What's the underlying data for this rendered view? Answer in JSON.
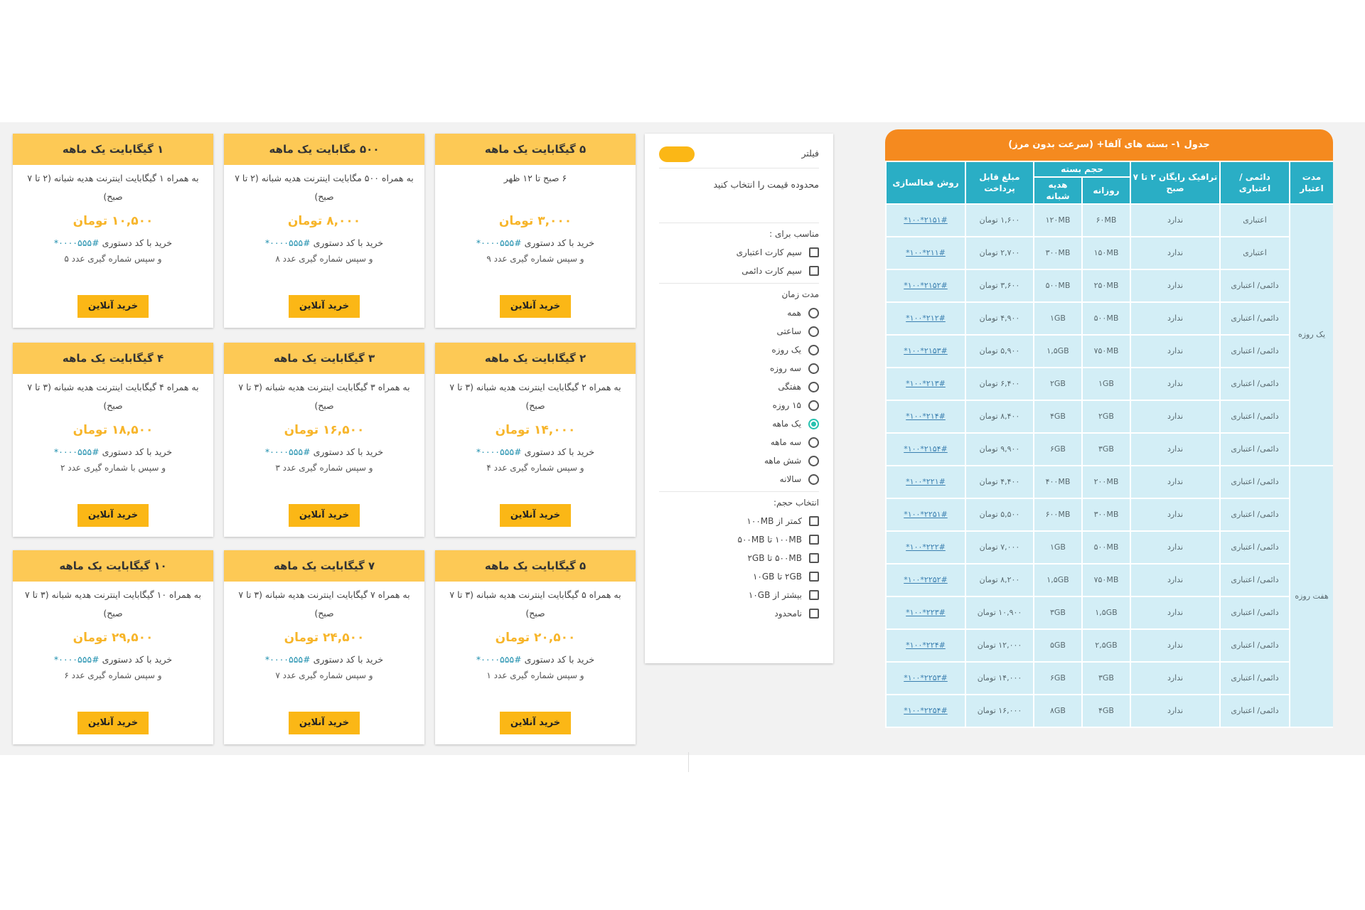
{
  "cards": [
    {
      "title": "۵ گیگابایت یک ماهه",
      "desc": "۶ صبح تا ۱۲ ظهر",
      "price": "۳,۰۰۰ تومان",
      "code_label": "خرید با کد دستوری",
      "code_value": "#۰۰۰۰۵۵۵*",
      "note": "و سپس شماره گیری عدد ۹",
      "button": "خرید آنلاین"
    },
    {
      "title": "۵۰۰ مگابایت یک ماهه",
      "desc": "به همراه ۵۰۰ مگابایت اینترنت هدیه شبانه (۲ تا ۷ صبح)",
      "price": "۸,۰۰۰ تومان",
      "code_label": "خرید با کد دستوری",
      "code_value": "#۰۰۰۰۵۵۵*",
      "note": "و سپس شماره گیری عدد ۸",
      "button": "خرید آنلاین"
    },
    {
      "title": "۱ گیگابایت یک ماهه",
      "desc": "به همراه ۱ گیگابایت اینترنت هدیه شبانه (۲ تا ۷ صبح)",
      "price": "۱۰,۵۰۰ تومان",
      "code_label": "خرید با کد دستوری",
      "code_value": "#۰۰۰۰۵۵۵*",
      "note": "و سپس شماره گیری عدد ۵",
      "button": "خرید آنلاین"
    },
    {
      "title": "۲ گیگابایت یک ماهه",
      "desc": "به همراه ۲ گیگابایت اینترنت هدیه شبانه (۳ تا ۷ صبح)",
      "price": "۱۴,۰۰۰ تومان",
      "code_label": "خرید با کد دستوری",
      "code_value": "#۰۰۰۰۵۵۵*",
      "note": "و سپس شماره گیری عدد ۴",
      "button": "خرید آنلاین"
    },
    {
      "title": "۳ گیگابایت یک ماهه",
      "desc": "به همراه ۳ گیگابایت اینترنت هدیه شبانه (۳ تا ۷ صبح)",
      "price": "۱۶,۵۰۰ تومان",
      "code_label": "خرید با کد دستوری",
      "code_value": "#۰۰۰۰۵۵۵*",
      "note": "و سپس شماره گیری عدد ۳",
      "button": "خرید آنلاین"
    },
    {
      "title": "۴ گیگابایت یک ماهه",
      "desc": "به همراه ۴ گیگابایت اینترنت هدیه شبانه (۳ تا ۷ صبح)",
      "price": "۱۸,۵۰۰ تومان",
      "code_label": "خرید با کد دستوری",
      "code_value": "#۰۰۰۰۵۵۵*",
      "note": "و سپس با شماره گیری عدد ۲",
      "button": "خرید آنلاین"
    },
    {
      "title": "۵ گیگابایت یک ماهه",
      "desc": "به همراه ۵ گیگابایت اینترنت هدیه شبانه (۳ تا ۷ صبح)",
      "price": "۲۰,۵۰۰ تومان",
      "code_label": "خرید با کد دستوری",
      "code_value": "#۰۰۰۰۵۵۵*",
      "note": "و سپس شماره گیری عدد ۱",
      "button": "خرید آنلاین"
    },
    {
      "title": "۷ گیگابایت یک ماهه",
      "desc": "به همراه ۷ گیگابایت اینترنت هدیه شبانه (۳ تا ۷ صبح)",
      "price": "۲۴,۵۰۰ تومان",
      "code_label": "خرید با کد دستوری",
      "code_value": "#۰۰۰۰۵۵۵*",
      "note": "و سپس شماره گیری عدد ۷",
      "button": "خرید آنلاین"
    },
    {
      "title": "۱۰ گیگابایت یک ماهه",
      "desc": "به همراه ۱۰ گیگابایت اینترنت هدیه شبانه (۳ تا ۷ صبح)",
      "price": "۲۹,۵۰۰ تومان",
      "code_label": "خرید با کد دستوری",
      "code_value": "#۰۰۰۰۵۵۵*",
      "note": "و سپس شماره گیری عدد ۶",
      "button": "خرید آنلاین"
    }
  ],
  "filter": {
    "title": "فیلتر",
    "toggle_color": "#fbb716",
    "price_hint": "محدوده قیمت را انتخاب کنید",
    "suitable_title": "مناسب برای :",
    "suitable_options": [
      "سیم کارت اعتباری",
      "سیم کارت دائمی"
    ],
    "duration_title": "مدت زمان",
    "duration_options": [
      "همه",
      "ساعتی",
      "یک روزه",
      "سه روزه",
      "هفتگی",
      "۱۵ روزه",
      "یک ماهه",
      "سه ماهه",
      "شش ماهه",
      "سالانه"
    ],
    "duration_selected": "یک ماهه",
    "volume_title": "انتخاب حجم:",
    "volume_options": [
      "کمتر از ۱۰۰MB",
      "۱۰۰MB تا ۵۰۰MB",
      "۵۰۰MB تا ۲GB",
      "۲GB تا ۱۰GB",
      "بیشتر از ۱۰GB",
      "نامحدود"
    ]
  },
  "table": {
    "title": "جدول ۱- بسته های آلفا+ (سرعت بدون مرز)",
    "header_color": "#2aaec5",
    "title_color": "#f58a1f",
    "headers": {
      "period": "مدت اعتبار",
      "sim": "دائمی / اعتباری",
      "free_traffic": "ترافیک رایگان ۲ تا ۷ صبح",
      "volume_group": "حجم بسته",
      "daily": "روزانه",
      "night": "هدیه شبانه",
      "amount": "مبلغ قابل پرداخت",
      "activation": "روش فعالسازی"
    },
    "groups": [
      {
        "period": "یک روزه",
        "rows": [
          {
            "sim": "اعتباری",
            "free": "ندارد",
            "daily": "۶۰MB",
            "night": "۱۲۰MB",
            "amount": "۱,۶۰۰ تومان",
            "code": "*۱۰۰*۲۱۵۱#"
          },
          {
            "sim": "اعتباری",
            "free": "ندارد",
            "daily": "۱۵۰MB",
            "night": "۳۰۰MB",
            "amount": "۲,۷۰۰ تومان",
            "code": "*۱۰۰*۲۱۱#"
          },
          {
            "sim": "دائمی/ اعتباری",
            "free": "ندارد",
            "daily": "۲۵۰MB",
            "night": "۵۰۰MB",
            "amount": "۳,۶۰۰ تومان",
            "code": "*۱۰۰*۲۱۵۲#"
          },
          {
            "sim": "دائمی/ اعتباری",
            "free": "ندارد",
            "daily": "۵۰۰MB",
            "night": "۱GB",
            "amount": "۴,۹۰۰ تومان",
            "code": "*۱۰۰*۲۱۲#"
          },
          {
            "sim": "دائمی/ اعتباری",
            "free": "ندارد",
            "daily": "۷۵۰MB",
            "night": "۱,۵GB",
            "amount": "۵,۹۰۰ تومان",
            "code": "*۱۰۰*۲۱۵۳#"
          },
          {
            "sim": "دائمی/ اعتباری",
            "free": "ندارد",
            "daily": "۱GB",
            "night": "۲GB",
            "amount": "۶,۴۰۰ تومان",
            "code": "*۱۰۰*۲۱۳#"
          },
          {
            "sim": "دائمی/ اعتباری",
            "free": "ندارد",
            "daily": "۲GB",
            "night": "۴GB",
            "amount": "۸,۴۰۰ تومان",
            "code": "*۱۰۰*۲۱۴#"
          },
          {
            "sim": "دائمی/ اعتباری",
            "free": "ندارد",
            "daily": "۳GB",
            "night": "۶GB",
            "amount": "۹,۹۰۰ تومان",
            "code": "*۱۰۰*۲۱۵۴#"
          }
        ]
      },
      {
        "period": "هفت روزه",
        "rows": [
          {
            "sim": "دائمی/ اعتباری",
            "free": "ندارد",
            "daily": "۲۰۰MB",
            "night": "۴۰۰MB",
            "amount": "۴,۴۰۰ تومان",
            "code": "*۱۰۰*۲۲۱#"
          },
          {
            "sim": "دائمی/ اعتباری",
            "free": "ندارد",
            "daily": "۳۰۰MB",
            "night": "۶۰۰MB",
            "amount": "۵,۵۰۰ تومان",
            "code": "*۱۰۰*۲۲۵۱#"
          },
          {
            "sim": "دائمی/ اعتباری",
            "free": "ندارد",
            "daily": "۵۰۰MB",
            "night": "۱GB",
            "amount": "۷,۰۰۰ تومان",
            "code": "*۱۰۰*۲۲۲#"
          },
          {
            "sim": "دائمی/ اعتباری",
            "free": "ندارد",
            "daily": "۷۵۰MB",
            "night": "۱,۵GB",
            "amount": "۸,۲۰۰ تومان",
            "code": "*۱۰۰*۲۲۵۲#"
          },
          {
            "sim": "دائمی/ اعتباری",
            "free": "ندارد",
            "daily": "۱,۵GB",
            "night": "۳GB",
            "amount": "۱۰,۹۰۰ تومان",
            "code": "*۱۰۰*۲۲۳#"
          },
          {
            "sim": "دائمی/ اعتباری",
            "free": "ندارد",
            "daily": "۲,۵GB",
            "night": "۵GB",
            "amount": "۱۲,۰۰۰ تومان",
            "code": "*۱۰۰*۲۲۴#"
          },
          {
            "sim": "دائمی/ اعتباری",
            "free": "ندارد",
            "daily": "۳GB",
            "night": "۶GB",
            "amount": "۱۴,۰۰۰ تومان",
            "code": "*۱۰۰*۲۲۵۳#"
          },
          {
            "sim": "دائمی/ اعتباری",
            "free": "ندارد",
            "daily": "۴GB",
            "night": "۸GB",
            "amount": "۱۶,۰۰۰ تومان",
            "code": "*۱۰۰*۲۲۵۴#"
          }
        ]
      }
    ]
  }
}
